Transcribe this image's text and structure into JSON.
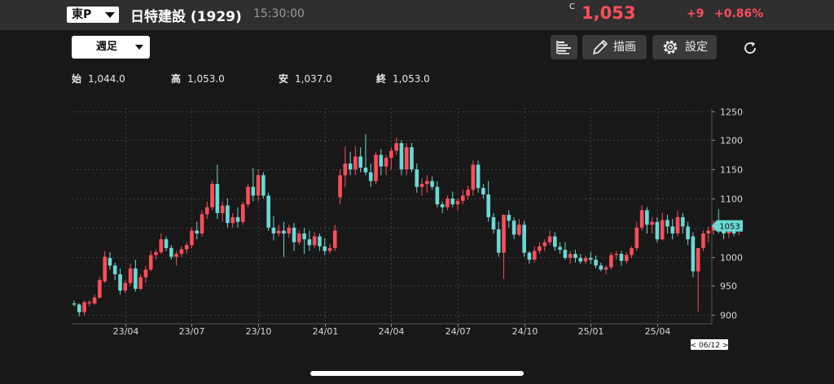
{
  "header": {
    "market": "東P",
    "stock_name": "日特建設 (1929)",
    "time": "15:30:00",
    "price_prefix": "C",
    "price": "1,053",
    "change": "+9",
    "change_pct": "+0.86%"
  },
  "toolbar": {
    "period": "週足",
    "draw_label": "描画",
    "settings_label": "設定"
  },
  "ohlc": {
    "open_label": "始",
    "open": "1,044.0",
    "high_label": "高",
    "high": "1,053.0",
    "low_label": "安",
    "low": "1,037.0",
    "close_label": "終",
    "close": "1,053.0"
  },
  "colors": {
    "up": "#ff4d5b",
    "down": "#6ad9d4",
    "price_tag": "#6ad9d4"
  },
  "chart_data": {
    "type": "candlestick",
    "period": "weekly",
    "ylim": [
      885,
      1255
    ],
    "y_ticks": [
      1250,
      1200,
      1150,
      1100,
      1050,
      1000,
      950,
      900
    ],
    "x_ticks": [
      {
        "label": "23/04",
        "index": 10
      },
      {
        "label": "23/07",
        "index": 23
      },
      {
        "label": "23/10",
        "index": 36
      },
      {
        "label": "24/01",
        "index": 49
      },
      {
        "label": "24/04",
        "index": 62
      },
      {
        "label": "24/07",
        "index": 75
      },
      {
        "label": "24/10",
        "index": 88
      },
      {
        "label": "25/01",
        "index": 101
      },
      {
        "label": "25/04",
        "index": 114
      }
    ],
    "last_price_tag": "1053",
    "last_date_tag": "< 06/12 >",
    "candles": [
      [
        920,
        925,
        915,
        918
      ],
      [
        918,
        920,
        898,
        905
      ],
      [
        905,
        925,
        900,
        922
      ],
      [
        920,
        925,
        915,
        922
      ],
      [
        920,
        935,
        918,
        930
      ],
      [
        930,
        965,
        928,
        960
      ],
      [
        958,
        1010,
        955,
        1000
      ],
      [
        998,
        1008,
        978,
        985
      ],
      [
        985,
        990,
        960,
        970
      ],
      [
        970,
        980,
        935,
        942
      ],
      [
        942,
        960,
        938,
        955
      ],
      [
        955,
        988,
        950,
        980
      ],
      [
        980,
        995,
        940,
        945
      ],
      [
        945,
        970,
        942,
        965
      ],
      [
        965,
        985,
        955,
        978
      ],
      [
        978,
        1010,
        975,
        1003
      ],
      [
        1003,
        1012,
        995,
        1008
      ],
      [
        1008,
        1040,
        1005,
        1030
      ],
      [
        1030,
        1035,
        1010,
        1015
      ],
      [
        1015,
        1020,
        995,
        1000
      ],
      [
        1000,
        1010,
        985,
        1005
      ],
      [
        1005,
        1018,
        1000,
        1013
      ],
      [
        1013,
        1025,
        1005,
        1020
      ],
      [
        1020,
        1050,
        1015,
        1045
      ],
      [
        1045,
        1060,
        1030,
        1040
      ],
      [
        1040,
        1080,
        1035,
        1073
      ],
      [
        1073,
        1095,
        1065,
        1085
      ],
      [
        1085,
        1130,
        1080,
        1125
      ],
      [
        1125,
        1158,
        1065,
        1075
      ],
      [
        1075,
        1095,
        1060,
        1088
      ],
      [
        1088,
        1100,
        1050,
        1058
      ],
      [
        1058,
        1075,
        1050,
        1068
      ],
      [
        1068,
        1085,
        1050,
        1060
      ],
      [
        1060,
        1095,
        1055,
        1090
      ],
      [
        1090,
        1125,
        1085,
        1120
      ],
      [
        1120,
        1152,
        1095,
        1105
      ],
      [
        1105,
        1150,
        1095,
        1140
      ],
      [
        1140,
        1145,
        1100,
        1105
      ],
      [
        1105,
        1110,
        1045,
        1050
      ],
      [
        1050,
        1070,
        1028,
        1040
      ],
      [
        1040,
        1055,
        1035,
        1045
      ],
      [
        1045,
        1060,
        1000,
        1040
      ],
      [
        1040,
        1055,
        1033,
        1050
      ],
      [
        1050,
        1058,
        1010,
        1025
      ],
      [
        1025,
        1045,
        1020,
        1040
      ],
      [
        1040,
        1050,
        1005,
        1030
      ],
      [
        1030,
        1045,
        1010,
        1020
      ],
      [
        1020,
        1042,
        1015,
        1035
      ],
      [
        1035,
        1040,
        1010,
        1018
      ],
      [
        1018,
        1032,
        1003,
        1010
      ],
      [
        1010,
        1022,
        1005,
        1015
      ],
      [
        1015,
        1055,
        1010,
        1045
      ],
      [
        1102,
        1150,
        1090,
        1140
      ],
      [
        1140,
        1190,
        1120,
        1160
      ],
      [
        1160,
        1180,
        1140,
        1150
      ],
      [
        1150,
        1190,
        1140,
        1172
      ],
      [
        1172,
        1188,
        1145,
        1153
      ],
      [
        1153,
        1210,
        1140,
        1145
      ],
      [
        1145,
        1160,
        1120,
        1130
      ],
      [
        1130,
        1180,
        1125,
        1175
      ],
      [
        1175,
        1185,
        1140,
        1155
      ],
      [
        1155,
        1175,
        1140,
        1170
      ],
      [
        1170,
        1188,
        1150,
        1182
      ],
      [
        1182,
        1205,
        1175,
        1195
      ],
      [
        1195,
        1200,
        1140,
        1150
      ],
      [
        1150,
        1195,
        1140,
        1188
      ],
      [
        1188,
        1195,
        1145,
        1150
      ],
      [
        1150,
        1160,
        1110,
        1120
      ],
      [
        1120,
        1135,
        1105,
        1125
      ],
      [
        1125,
        1140,
        1110,
        1130
      ],
      [
        1130,
        1138,
        1115,
        1120
      ],
      [
        1120,
        1130,
        1085,
        1090
      ],
      [
        1090,
        1095,
        1075,
        1085
      ],
      [
        1085,
        1105,
        1080,
        1100
      ],
      [
        1100,
        1112,
        1085,
        1090
      ],
      [
        1090,
        1100,
        1080,
        1096
      ],
      [
        1096,
        1115,
        1090,
        1105
      ],
      [
        1105,
        1122,
        1098,
        1115
      ],
      [
        1115,
        1165,
        1105,
        1158
      ],
      [
        1158,
        1165,
        1110,
        1118
      ],
      [
        1118,
        1125,
        1100,
        1107
      ],
      [
        1107,
        1130,
        1060,
        1068
      ],
      [
        1068,
        1075,
        1040,
        1047
      ],
      [
        1047,
        1060,
        1000,
        1007
      ],
      [
        1007,
        1012,
        962,
        1072
      ],
      [
        1072,
        1080,
        1050,
        1062
      ],
      [
        1062,
        1068,
        1030,
        1038
      ],
      [
        1038,
        1065,
        1035,
        1055
      ],
      [
        1055,
        1062,
        1000,
        1007
      ],
      [
        1007,
        1010,
        988,
        995
      ],
      [
        995,
        1018,
        990,
        1010
      ],
      [
        1010,
        1025,
        1005,
        1018
      ],
      [
        1018,
        1030,
        1010,
        1025
      ],
      [
        1025,
        1045,
        1020,
        1035
      ],
      [
        1035,
        1042,
        1010,
        1017
      ],
      [
        1017,
        1025,
        1005,
        1012
      ],
      [
        1012,
        1025,
        995,
        998
      ],
      [
        998,
        1010,
        988,
        1005
      ],
      [
        1005,
        1012,
        990,
        998
      ],
      [
        998,
        1005,
        988,
        992
      ],
      [
        992,
        1002,
        988,
        998
      ],
      [
        998,
        1008,
        988,
        995
      ],
      [
        995,
        1002,
        980,
        985
      ],
      [
        985,
        990,
        975,
        978
      ],
      [
        978,
        985,
        970,
        982
      ],
      [
        982,
        1008,
        978,
        1003
      ],
      [
        1003,
        1010,
        995,
        1005
      ],
      [
        1005,
        1010,
        985,
        993
      ],
      [
        993,
        1008,
        988,
        1003
      ],
      [
        1003,
        1018,
        998,
        1015
      ],
      [
        1015,
        1060,
        1010,
        1050
      ],
      [
        1050,
        1088,
        1045,
        1080
      ],
      [
        1080,
        1085,
        1040,
        1055
      ],
      [
        1055,
        1068,
        1040,
        1060
      ],
      [
        1060,
        1068,
        1025,
        1030
      ],
      [
        1030,
        1075,
        1028,
        1063
      ],
      [
        1063,
        1072,
        1040,
        1052
      ],
      [
        1052,
        1065,
        1030,
        1040
      ],
      [
        1040,
        1080,
        1035,
        1068
      ],
      [
        1068,
        1075,
        1040,
        1052
      ],
      [
        1052,
        1060,
        1020,
        1030
      ],
      [
        1035,
        1042,
        965,
        975
      ],
      [
        975,
        1015,
        906,
        1015
      ],
      [
        1015,
        1045,
        1010,
        1040
      ],
      [
        1040,
        1052,
        1025,
        1045
      ],
      [
        1045,
        1062,
        1038,
        1055
      ],
      [
        1055,
        1082,
        1040,
        1045
      ],
      [
        1045,
        1058,
        1030,
        1040
      ],
      [
        1040,
        1055,
        1032,
        1048
      ],
      [
        1048,
        1050,
        1035,
        1040
      ],
      [
        1044,
        1053,
        1037,
        1053
      ]
    ]
  }
}
